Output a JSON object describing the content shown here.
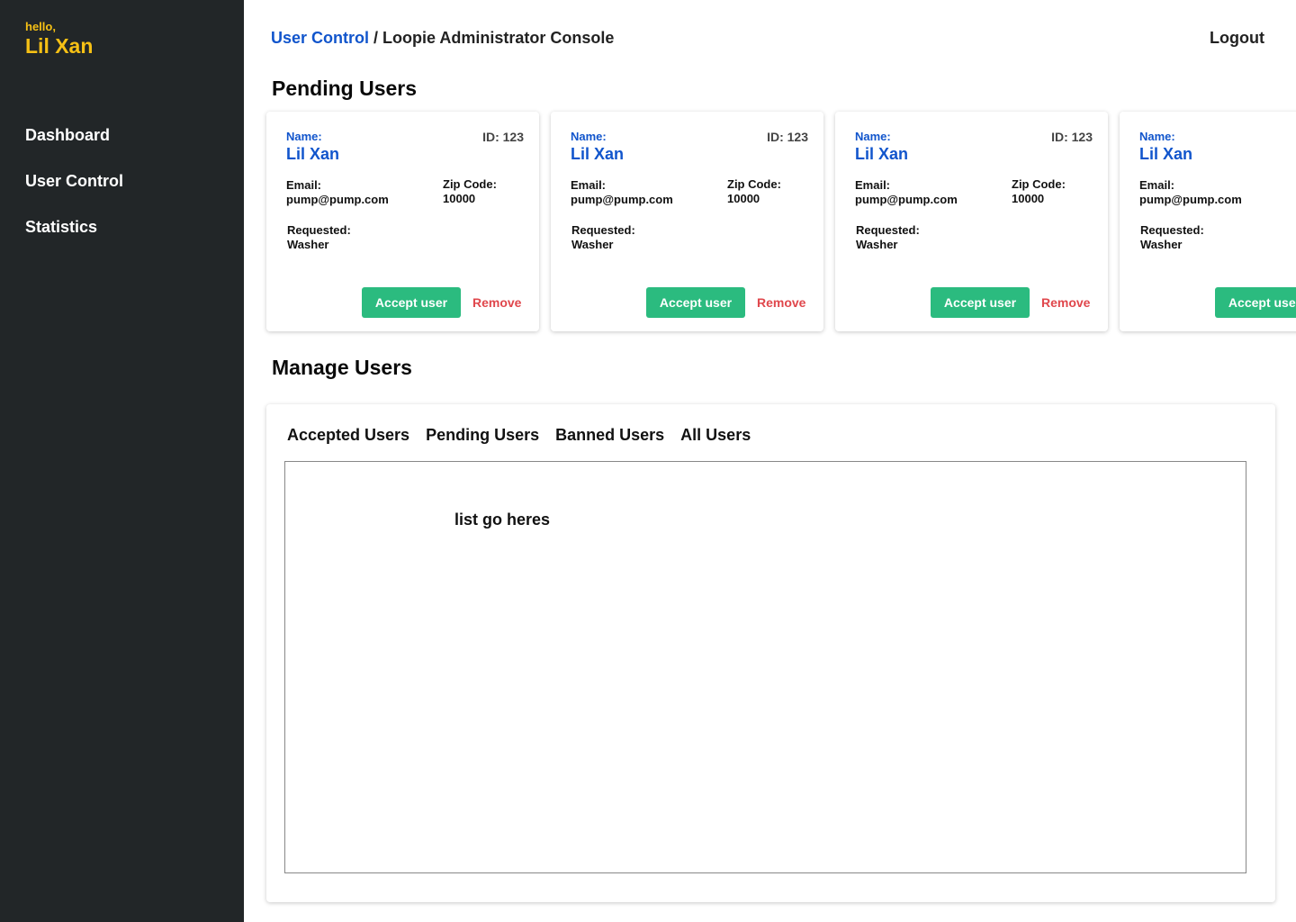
{
  "sidebar": {
    "greeting": "hello,",
    "user_name": "Lil Xan",
    "nav": [
      {
        "label": "Dashboard"
      },
      {
        "label": "User Control"
      },
      {
        "label": "Statistics"
      }
    ]
  },
  "header": {
    "breadcrumb_link": "User Control",
    "breadcrumb_separator": " / ",
    "breadcrumb_current": "Loopie Administrator Console",
    "logout_label": "Logout"
  },
  "pending": {
    "title": "Pending Users",
    "cards": [
      {
        "name_label": "Name:",
        "name": "Lil Xan",
        "id": "ID: 123",
        "email_label": "Email:",
        "email": "pump@pump.com",
        "zip_label": "Zip Code:",
        "zip": "10000",
        "requested_label": "Requested:",
        "requested": "Washer",
        "accept_label": "Accept user",
        "remove_label": "Remove"
      },
      {
        "name_label": "Name:",
        "name": "Lil Xan",
        "id": "ID: 123",
        "email_label": "Email:",
        "email": "pump@pump.com",
        "zip_label": "Zip Code:",
        "zip": "10000",
        "requested_label": "Requested:",
        "requested": "Washer",
        "accept_label": "Accept user",
        "remove_label": "Remove"
      },
      {
        "name_label": "Name:",
        "name": "Lil Xan",
        "id": "ID: 123",
        "email_label": "Email:",
        "email": "pump@pump.com",
        "zip_label": "Zip Code:",
        "zip": "10000",
        "requested_label": "Requested:",
        "requested": "Washer",
        "accept_label": "Accept user",
        "remove_label": "Remove"
      },
      {
        "name_label": "Name:",
        "name": "Lil Xan",
        "email_label": "Email:",
        "email": "pump@pump.com",
        "requested_label": "Requested:",
        "requested": "Washer",
        "accept_label": "Accept user"
      }
    ]
  },
  "manage": {
    "title": "Manage Users",
    "tabs": [
      {
        "label": "Accepted Users"
      },
      {
        "label": "Pending Users"
      },
      {
        "label": "Banned Users"
      },
      {
        "label": "All Users"
      }
    ],
    "list_placeholder": "list go heres"
  },
  "colors": {
    "sidebar_bg": "#222628",
    "accent_yellow": "#f6c015",
    "link_blue": "#1155cc",
    "accept_green": "#2bbb7f",
    "remove_red": "#e0474c"
  }
}
